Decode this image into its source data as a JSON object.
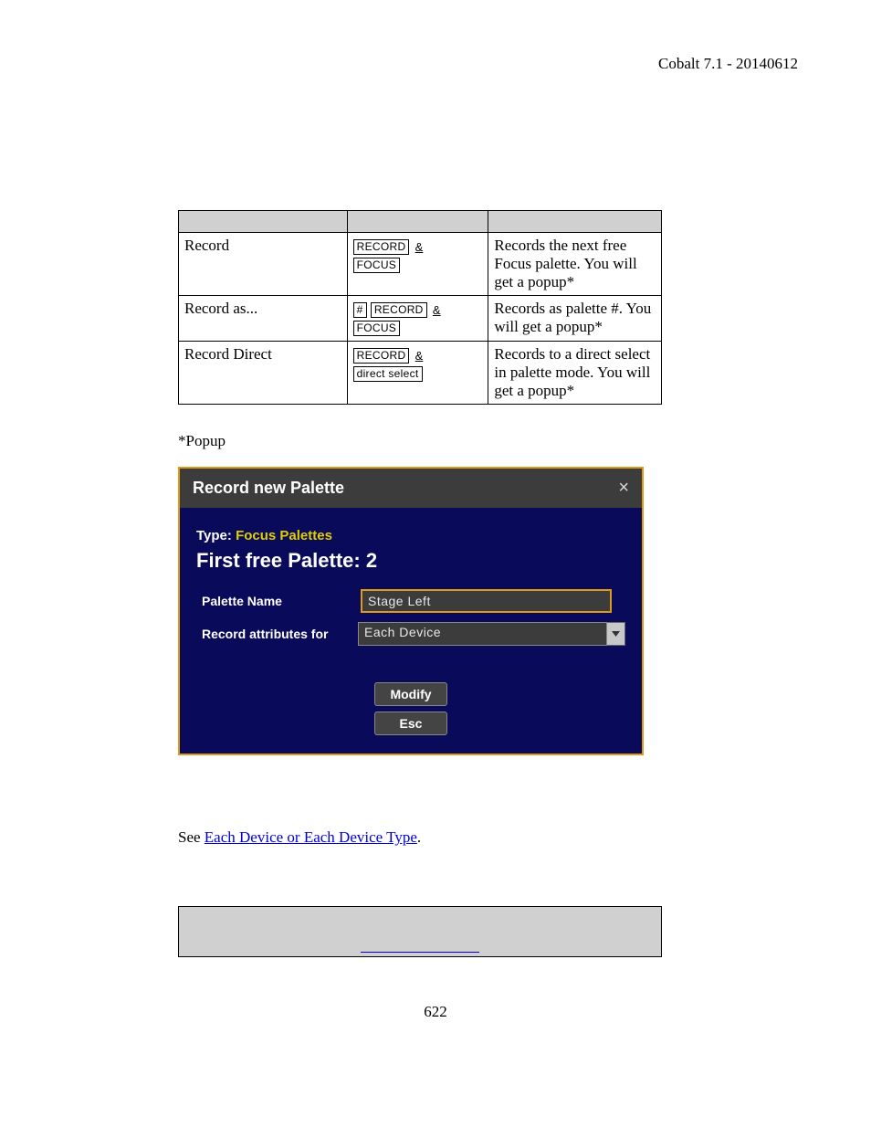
{
  "header": "Cobalt 7.1 - 20140612",
  "table": {
    "rows": [
      {
        "action": "Record",
        "keys": [
          [
            "RECORD",
            "&"
          ],
          [
            "FOCUS"
          ]
        ],
        "desc": "Records the next free Focus palette. You will get a popup*"
      },
      {
        "action": "Record as...",
        "keys": [
          [
            "#",
            "RECORD",
            "&"
          ],
          [
            "FOCUS"
          ]
        ],
        "desc": "Records as palette #. You will get a popup*"
      },
      {
        "action": "Record Direct",
        "keys": [
          [
            "RECORD",
            "&"
          ],
          [
            "direct select"
          ]
        ],
        "desc": "Records to a direct select in palette mode. You will get a popup*"
      }
    ]
  },
  "popup_note": "*Popup",
  "dialog": {
    "title": "Record new Palette",
    "type_label": "Type:",
    "type_value": "Focus Palettes",
    "free_label": "First free Palette: 2",
    "palette_name_label": "Palette Name",
    "palette_name_value": "Stage Left",
    "record_attr_label": "Record attributes for",
    "record_attr_value": "Each Device",
    "modify": "Modify",
    "esc": "Esc"
  },
  "see_prefix": "See ",
  "see_link": "Each Device or Each Device Type",
  "see_suffix": ".",
  "page_number": "622"
}
